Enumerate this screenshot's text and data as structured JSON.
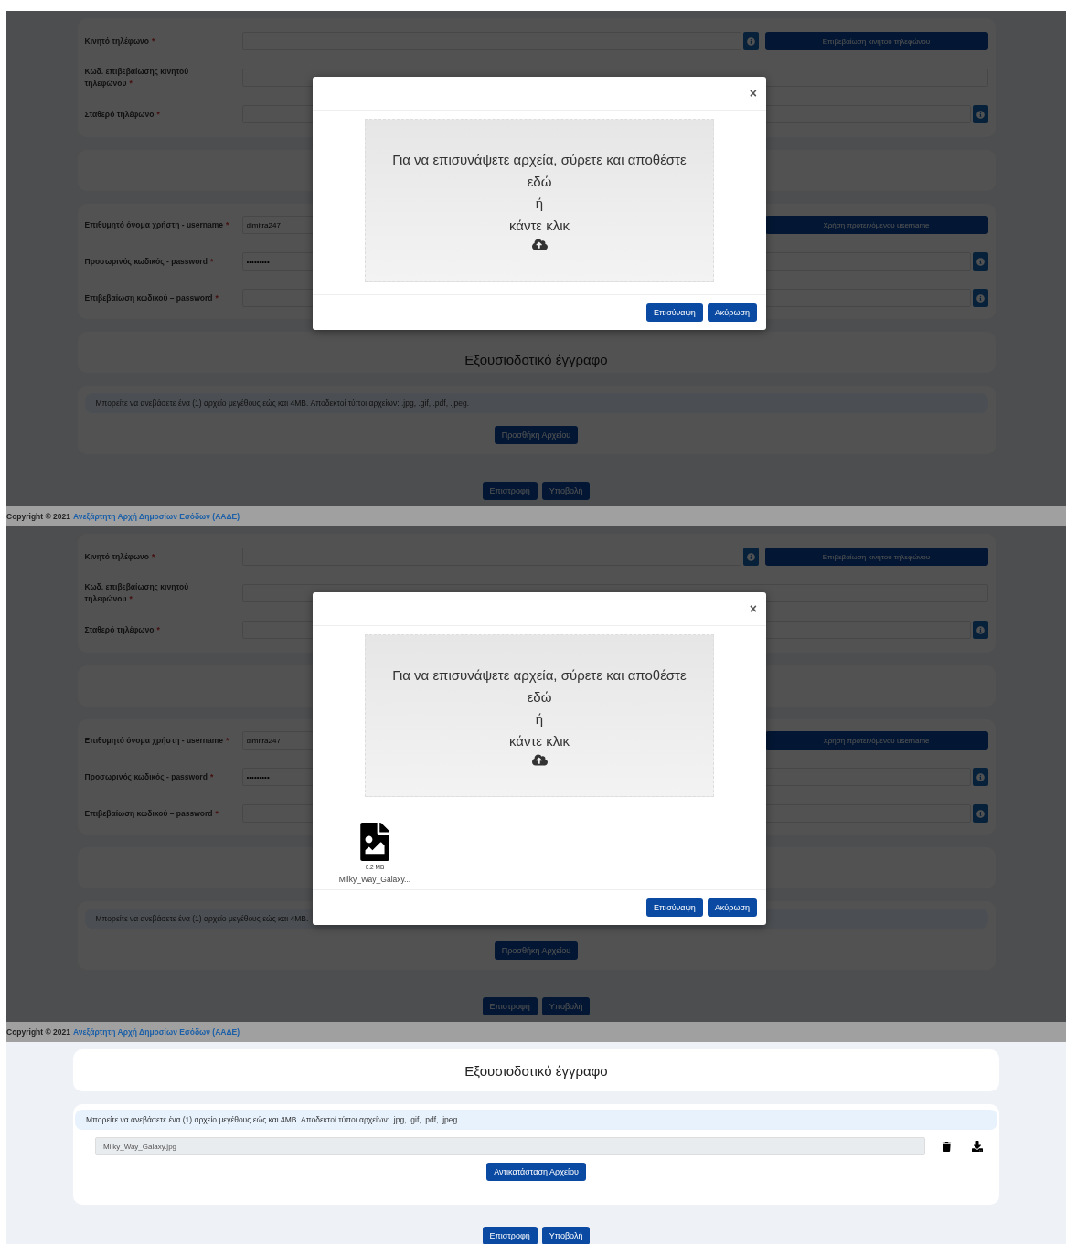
{
  "screens": [
    {
      "kind": "modal",
      "form": {
        "contact": [
          {
            "label": "Κινητό τηλέφωνο",
            "mark": "*",
            "info": true,
            "action": "Επιβεβαίωση κινητού τηλεφώνου"
          },
          {
            "label": "Κωδ. επιβεβαίωσης κινητού τηλεφώνου",
            "mark": "*",
            "info": false
          },
          {
            "label": "Σταθερό τηλέφωνο",
            "mark": "*",
            "info": true
          }
        ],
        "account": [
          {
            "label": "Επιθυμητό όνομα χρήστη - username",
            "mark": "*",
            "value": "dimitra247",
            "info": false,
            "action": "Χρήση προτεινόμενου username"
          },
          {
            "label": "Προσωρινός κωδικός - password",
            "mark": "*",
            "value": "•••••••••",
            "info": true
          },
          {
            "label": "Επιβεβαίωση κωδικού – password",
            "mark": "*",
            "info": true
          }
        ],
        "document": {
          "title": "Εξουσιοδοτικό έγγραφο",
          "notice": "Μπορείτε να ανεβάσετε ένα (1) αρχείο μεγέθους εώς και 4MB. Αποδεκτοί τύποι αρχείων: .jpg, .gif, .pdf, .jpeg.",
          "button": "Προσθήκη Αρχείου"
        },
        "actions": [
          "Επιστροφή",
          "Υποβολή"
        ]
      },
      "modal": {
        "close": "×",
        "dropzone": [
          "Για να επισυνάψετε αρχεία, σύρετε και αποθέστε εδώ",
          "ή",
          "κάντε κλικ"
        ],
        "buttons": [
          "Επισύναψη",
          "Ακύρωση"
        ]
      },
      "footer": {
        "copyright": "Copyright © 2021",
        "link": "Ανεξάρτητη Αρχή Δημοσίων Εσόδων (ΑΑΔΕ)"
      }
    },
    {
      "kind": "modal",
      "form": {
        "contact": [
          {
            "label": "Κινητό τηλέφωνο",
            "mark": "*",
            "info": true,
            "action": "Επιβεβαίωση κινητού τηλεφώνου"
          },
          {
            "label": "Κωδ. επιβεβαίωσης κινητού τηλεφώνου",
            "mark": "*",
            "info": false
          },
          {
            "label": "Σταθερό τηλέφωνο",
            "mark": "*",
            "info": true
          }
        ],
        "account": [
          {
            "label": "Επιθυμητό όνομα χρήστη - username",
            "mark": "*",
            "value": "dimitra247",
            "info": false,
            "action": "Χρήση προτεινόμενου username"
          },
          {
            "label": "Προσωρινός κωδικός - password",
            "mark": "*",
            "value": "•••••••••",
            "info": true
          },
          {
            "label": "Επιβεβαίωση κωδικού – password",
            "mark": "*",
            "info": true
          }
        ],
        "document": {
          "notice": "Μπορείτε να ανεβάσετε ένα (1) αρχείο μεγέθους εώς και 4MB.",
          "button": "Προσθήκη Αρχείου"
        },
        "actions": [
          "Επιστροφή",
          "Υποβολή"
        ]
      },
      "modal": {
        "close": "×",
        "dropzone": [
          "Για να επισυνάψετε αρχεία, σύρετε και αποθέστε εδώ",
          "ή",
          "κάντε κλικ"
        ],
        "files": [
          {
            "size": "0.2 MB",
            "name": "Milky_Way_Galaxy..."
          }
        ],
        "buttons": [
          "Επισύναψη",
          "Ακύρωση"
        ]
      },
      "footer": {
        "copyright": "Copyright © 2021",
        "link": "Ανεξάρτητη Αρχή Δημοσίων Εσόδων (ΑΑΔΕ)"
      }
    },
    {
      "kind": "uploaded",
      "document": {
        "title": "Εξουσιοδοτικό έγγραφο",
        "notice": "Μπορείτε να ανεβάσετε ένα (1) αρχείο μεγέθους εώς και 4MB. Αποδεκτοί τύποι αρχείων: .jpg, .gif, .pdf, .jpeg.",
        "file": "Milky_Way_Galaxy.jpg",
        "button": "Αντικατάσταση Αρχείου"
      },
      "actions": [
        "Επιστροφή",
        "Υποβολή"
      ]
    }
  ]
}
